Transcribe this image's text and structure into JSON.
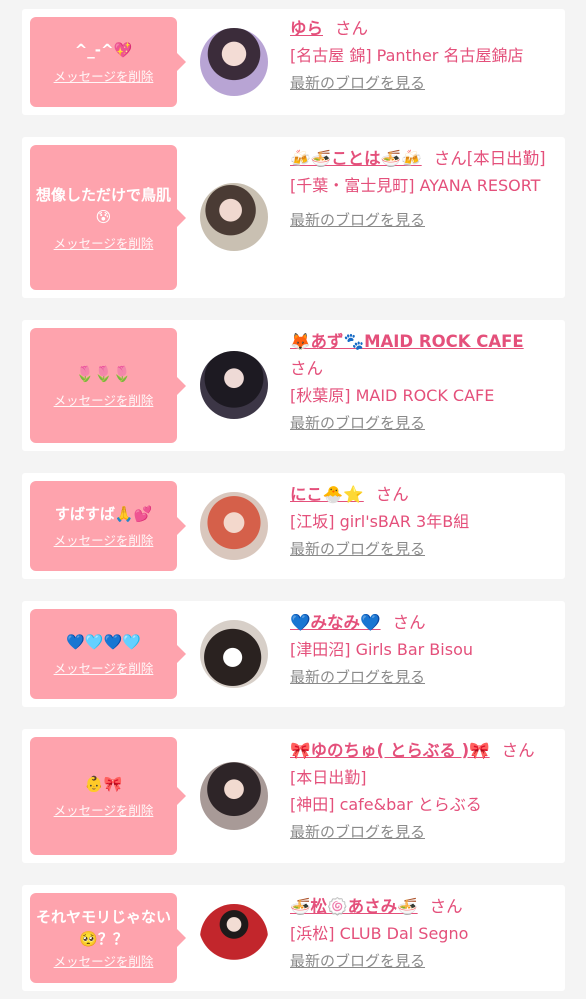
{
  "delete_label": "メッセージを削除",
  "san_label": "さん",
  "blog_label": "最新のブログを見る",
  "cards": [
    {
      "message": "^_-^💖",
      "name": "ゆら",
      "shop": "[名古屋 錦] Panther 名古屋錦店"
    },
    {
      "message": "想像しただけで鳥肌😰",
      "name": "🍻🍜ことは🍜🍻",
      "shop": "[本日出勤]",
      "shop2": "[千葉・富士見町] AYANA RESORT"
    },
    {
      "message": "🌷🌷🌷",
      "name": "🦊あず🐾MAID ROCK CAFE",
      "shop": "[秋葉原] MAID ROCK CAFE"
    },
    {
      "message": "すばすば🙏💕",
      "name": "にこ🐣⭐",
      "shop": "[江坂] girl'sBAR 3年B組"
    },
    {
      "message": "💙🩵💙🩵",
      "name": "💙みなみ💙",
      "shop": "[津田沼] Girls Bar Bisou"
    },
    {
      "message": "👶🎀",
      "name": "🎀ゆのちゅ( とらぶる )🎀",
      "shop": "[本日出勤]",
      "shop2": "[神田] cafe&bar とらぶる"
    },
    {
      "message": "それヤモリじゃない🥺？？",
      "name": "🍜松🍥あさみ🍜",
      "shop": "[浜松] CLUB Dal Segno"
    }
  ],
  "colors": {
    "bubble": "#fea3ad",
    "accent": "#e4507b",
    "muted": "#8a8a8a",
    "card": "#ffffff",
    "background": "#f4f4f4"
  }
}
